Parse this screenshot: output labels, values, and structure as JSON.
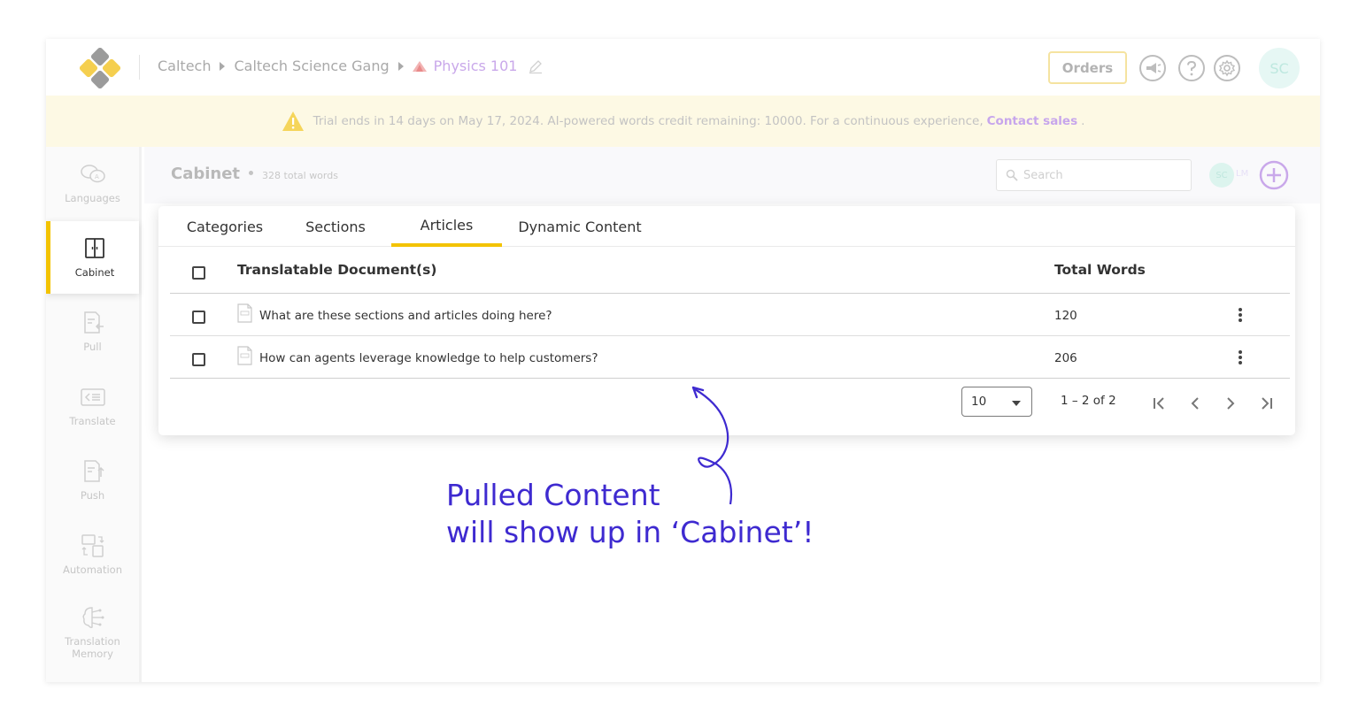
{
  "header": {
    "breadcrumb": [
      "Caltech",
      "Caltech Science Gang",
      "Physics 101"
    ],
    "orders_label": "Orders",
    "avatar_initials": "SC",
    "icons": [
      "megaphone-icon",
      "help-icon",
      "settings-icon"
    ]
  },
  "banner": {
    "text": "Trial ends in 14 days on May 17, 2024. AI-powered words credit remaining: 10000. For a continuous experience,",
    "link": "Contact sales",
    "suffix": "."
  },
  "sidebar": {
    "items": [
      {
        "label": "Languages",
        "icon": "languages-icon",
        "active": false
      },
      {
        "label": "Cabinet",
        "icon": "cabinet-icon",
        "active": true
      },
      {
        "label": "Pull",
        "icon": "pull-icon",
        "active": false
      },
      {
        "label": "Translate",
        "icon": "translate-icon",
        "active": false
      },
      {
        "label": "Push",
        "icon": "push-icon",
        "active": false
      },
      {
        "label": "Automation",
        "icon": "automation-icon",
        "active": false
      },
      {
        "label": "Translation Memory",
        "icon": "translation-memory-icon",
        "active": false
      }
    ]
  },
  "content": {
    "title": "Cabinet",
    "total_words": "328 total words",
    "search_placeholder": "Search",
    "member_initials": "SC",
    "member_initials_2": "LM"
  },
  "tabs": [
    {
      "label": "Categories",
      "active": false
    },
    {
      "label": "Sections",
      "active": false
    },
    {
      "label": "Articles",
      "active": true
    },
    {
      "label": "Dynamic Content",
      "active": false
    }
  ],
  "table": {
    "headers": {
      "document": "Translatable Document(s)",
      "words": "Total Words"
    },
    "rows": [
      {
        "title": "What are these sections and articles doing here?",
        "words": "120"
      },
      {
        "title": "How can agents leverage knowledge to help customers?",
        "words": "206"
      }
    ]
  },
  "pagination": {
    "page_size": "10",
    "range": "1 – 2 of 2"
  },
  "annotation": {
    "line1": "Pulled Content",
    "line2": "will show up in ‘Cabinet’!"
  },
  "colors": {
    "accent": "#f3c300",
    "annotation": "#3e2ad0",
    "banner_bg": "#fdf9e4",
    "link": "#c7a6ec"
  }
}
